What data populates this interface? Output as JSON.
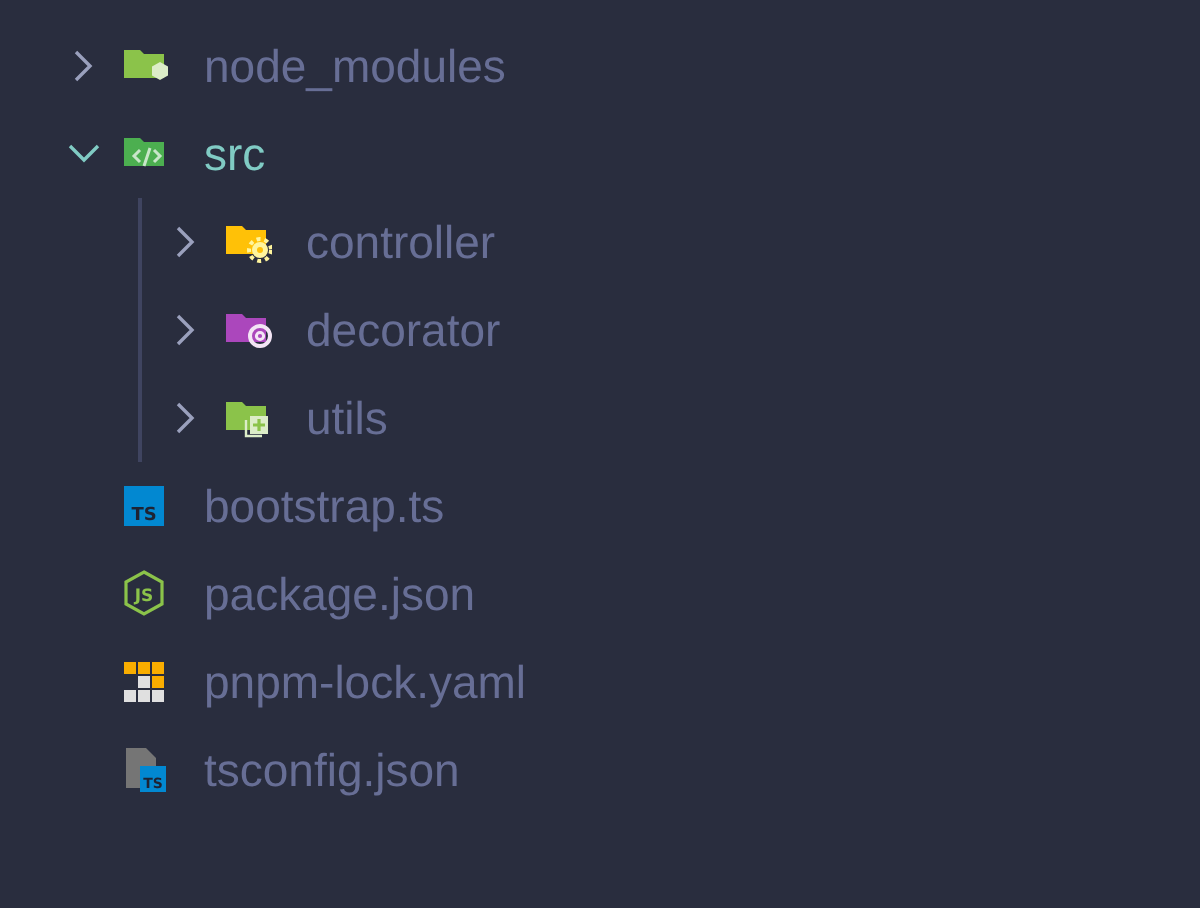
{
  "tree": [
    {
      "kind": "folder",
      "name": "node_modules",
      "expanded": false
    },
    {
      "kind": "folder",
      "name": "src",
      "expanded": true,
      "children": [
        {
          "kind": "folder",
          "name": "controller",
          "expanded": false
        },
        {
          "kind": "folder",
          "name": "decorator",
          "expanded": false
        },
        {
          "kind": "folder",
          "name": "utils",
          "expanded": false
        }
      ]
    },
    {
      "kind": "file",
      "name": "bootstrap.ts",
      "icon_text": "TS"
    },
    {
      "kind": "file",
      "name": "package.json",
      "icon_text": "JS"
    },
    {
      "kind": "file",
      "name": "pnpm-lock.yaml"
    },
    {
      "kind": "file",
      "name": "tsconfig.json",
      "icon_text": "TS"
    }
  ]
}
